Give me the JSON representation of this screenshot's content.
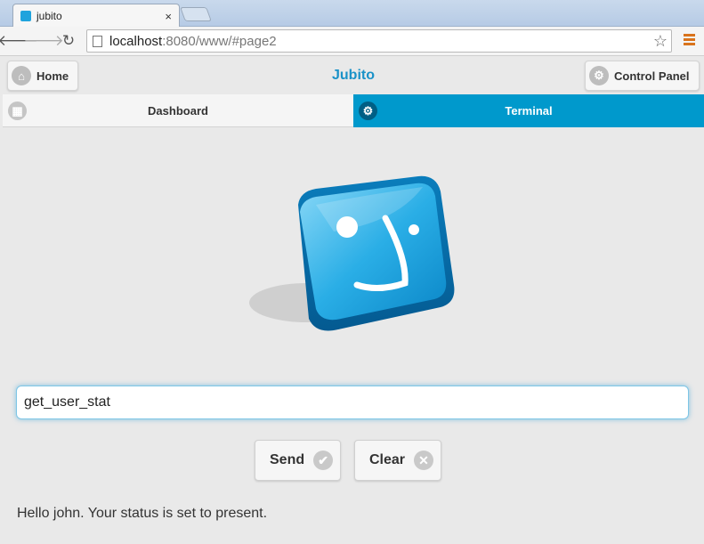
{
  "browser": {
    "tab_title": "jubito",
    "tab_close": "×",
    "url_host": "localhost",
    "url_path": ":8080/www/#page2",
    "star": "☆"
  },
  "header": {
    "home_label": "Home",
    "title": "Jubito",
    "control_panel_label": "Control Panel"
  },
  "tabs": [
    {
      "label": "Dashboard",
      "active": false,
      "icon": "grid-icon"
    },
    {
      "label": "Terminal",
      "active": true,
      "icon": "gear-icon"
    }
  ],
  "terminal": {
    "input_value": "get_user_stat",
    "send_label": "Send",
    "clear_label": "Clear",
    "output": "Hello john. Your status is set to present."
  },
  "colors": {
    "accent": "#0099cc",
    "title": "#1a92c8"
  }
}
